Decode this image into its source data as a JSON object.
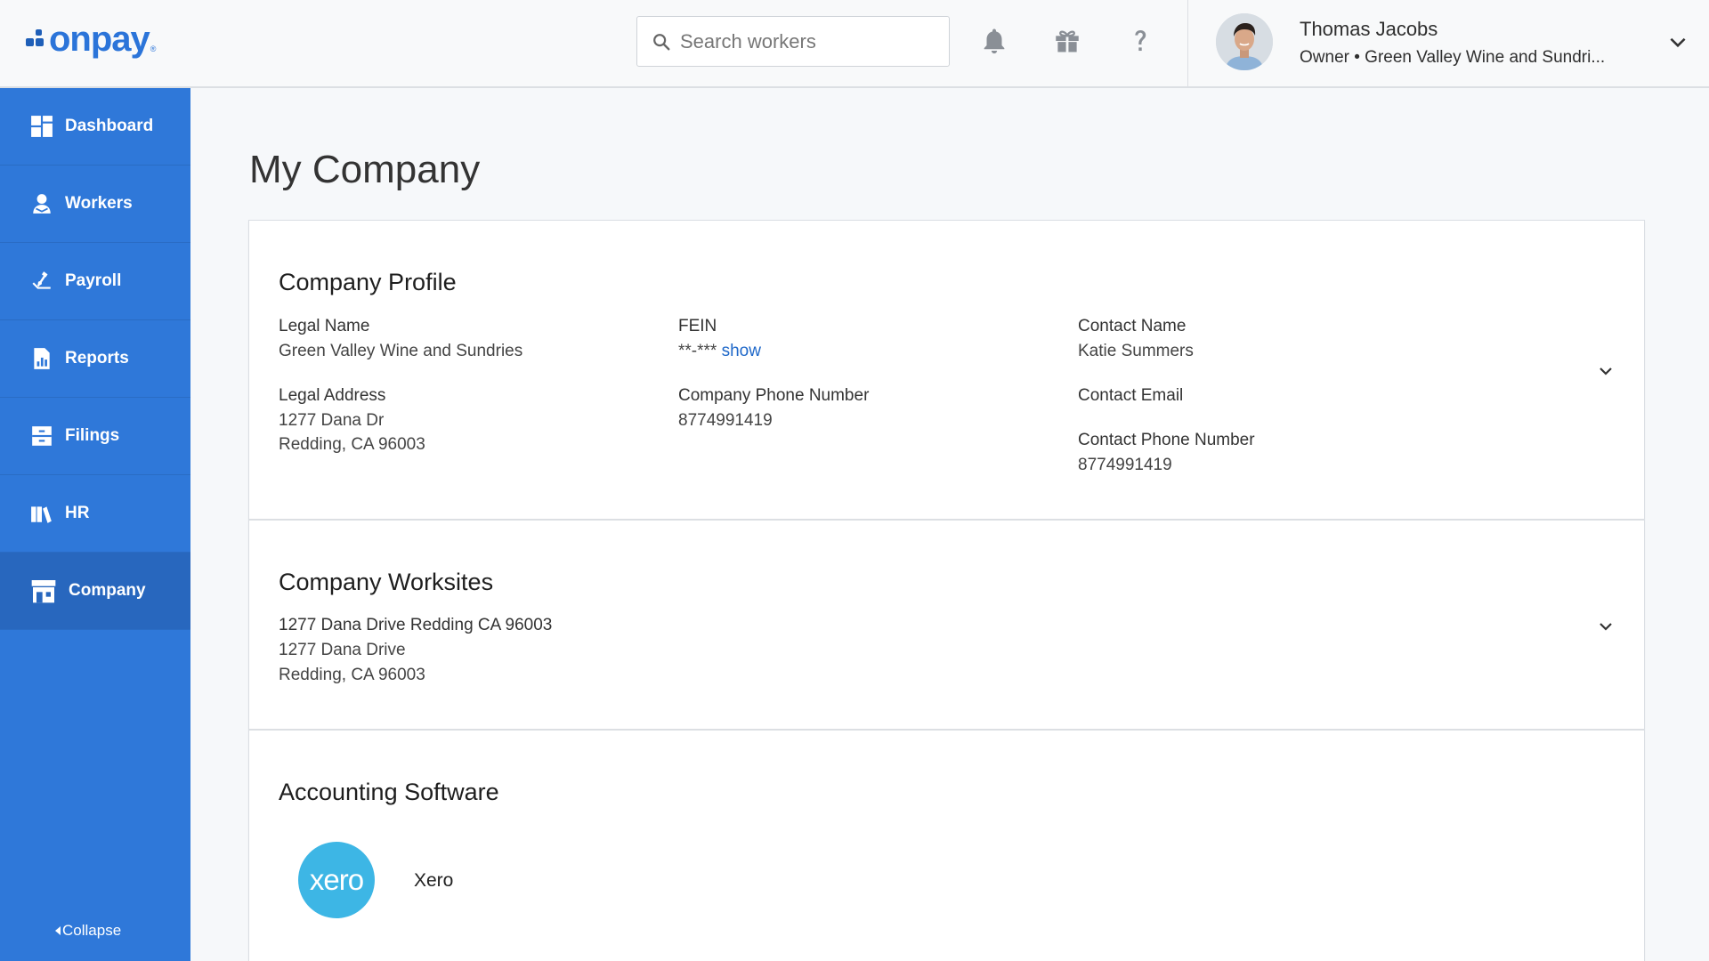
{
  "header": {
    "logo_text": "onpay",
    "logo_mark": "®",
    "search_placeholder": "Search workers",
    "icons": [
      "bell-icon",
      "gift-icon",
      "help-icon"
    ],
    "user": {
      "name": "Thomas Jacobs",
      "subtitle": "Owner • Green Valley Wine and Sundri..."
    }
  },
  "sidebar": {
    "items": [
      {
        "label": "Dashboard",
        "icon": "dashboard-icon"
      },
      {
        "label": "Workers",
        "icon": "workers-icon"
      },
      {
        "label": "Payroll",
        "icon": "payroll-icon"
      },
      {
        "label": "Reports",
        "icon": "reports-icon"
      },
      {
        "label": "Filings",
        "icon": "filings-icon"
      },
      {
        "label": "HR",
        "icon": "hr-icon"
      },
      {
        "label": "Company",
        "icon": "company-icon",
        "active": true
      }
    ],
    "collapse_label": "Collapse"
  },
  "page": {
    "title": "My Company"
  },
  "company_profile": {
    "title": "Company Profile",
    "legal_name_label": "Legal Name",
    "legal_name": "Green Valley Wine and Sundries",
    "legal_address_label": "Legal Address",
    "legal_address_line1": "1277 Dana Dr",
    "legal_address_line2": "Redding, CA 96003",
    "fein_label": "FEIN",
    "fein_masked": "**-***",
    "fein_show": "show",
    "company_phone_label": "Company Phone Number",
    "company_phone": "8774991419",
    "contact_name_label": "Contact Name",
    "contact_name": "Katie Summers",
    "contact_email_label": "Contact Email",
    "contact_phone_label": "Contact Phone Number",
    "contact_phone": "8774991419"
  },
  "company_worksites": {
    "title": "Company Worksites",
    "worksite_name": "1277 Dana Drive Redding CA 96003",
    "address_line1": "1277 Dana Drive",
    "address_line2": "Redding, CA 96003"
  },
  "accounting_software": {
    "title": "Accounting Software",
    "logo_text": "xero",
    "name": "Xero"
  },
  "colors": {
    "sidebar": "#2f78d9",
    "sidebar_active": "#2867be",
    "link": "#1f68c9",
    "xero": "#3db6e5"
  }
}
